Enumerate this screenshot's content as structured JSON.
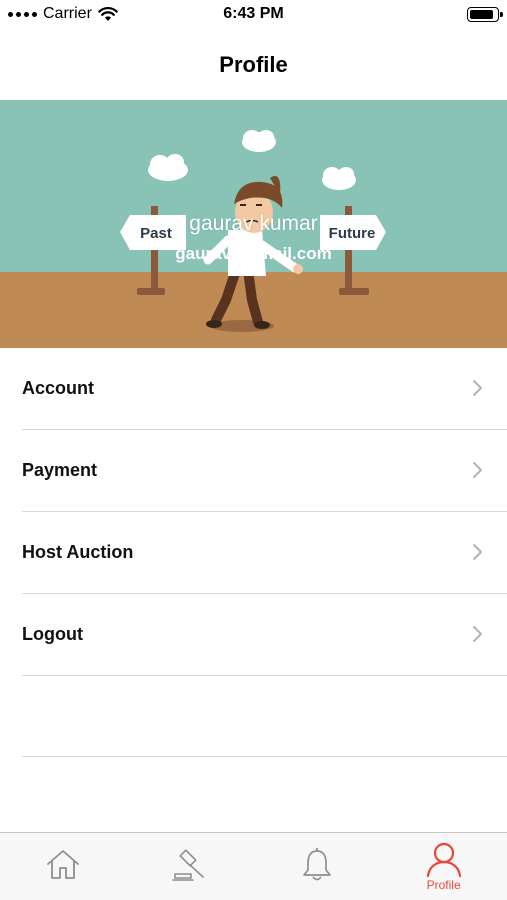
{
  "status_bar": {
    "carrier": "Carrier",
    "time": "6:43 PM"
  },
  "nav": {
    "title": "Profile"
  },
  "banner": {
    "sign_left": "Past",
    "sign_right": "Future",
    "user_name": "gaurav kumar",
    "user_email": "gaurav@gmail.com"
  },
  "menu": {
    "items": [
      {
        "label": "Account"
      },
      {
        "label": "Payment"
      },
      {
        "label": "Host Auction"
      },
      {
        "label": "Logout"
      }
    ]
  },
  "tab_bar": {
    "tabs": [
      {
        "icon": "home-icon",
        "label": ""
      },
      {
        "icon": "gavel-icon",
        "label": ""
      },
      {
        "icon": "bell-icon",
        "label": ""
      },
      {
        "icon": "profile-icon",
        "label": "Profile",
        "active": true
      }
    ]
  },
  "colors": {
    "accent": "#e8473a",
    "sky": "#88c3b5",
    "ground": "#c08a55",
    "divider": "#d8d8d8"
  }
}
